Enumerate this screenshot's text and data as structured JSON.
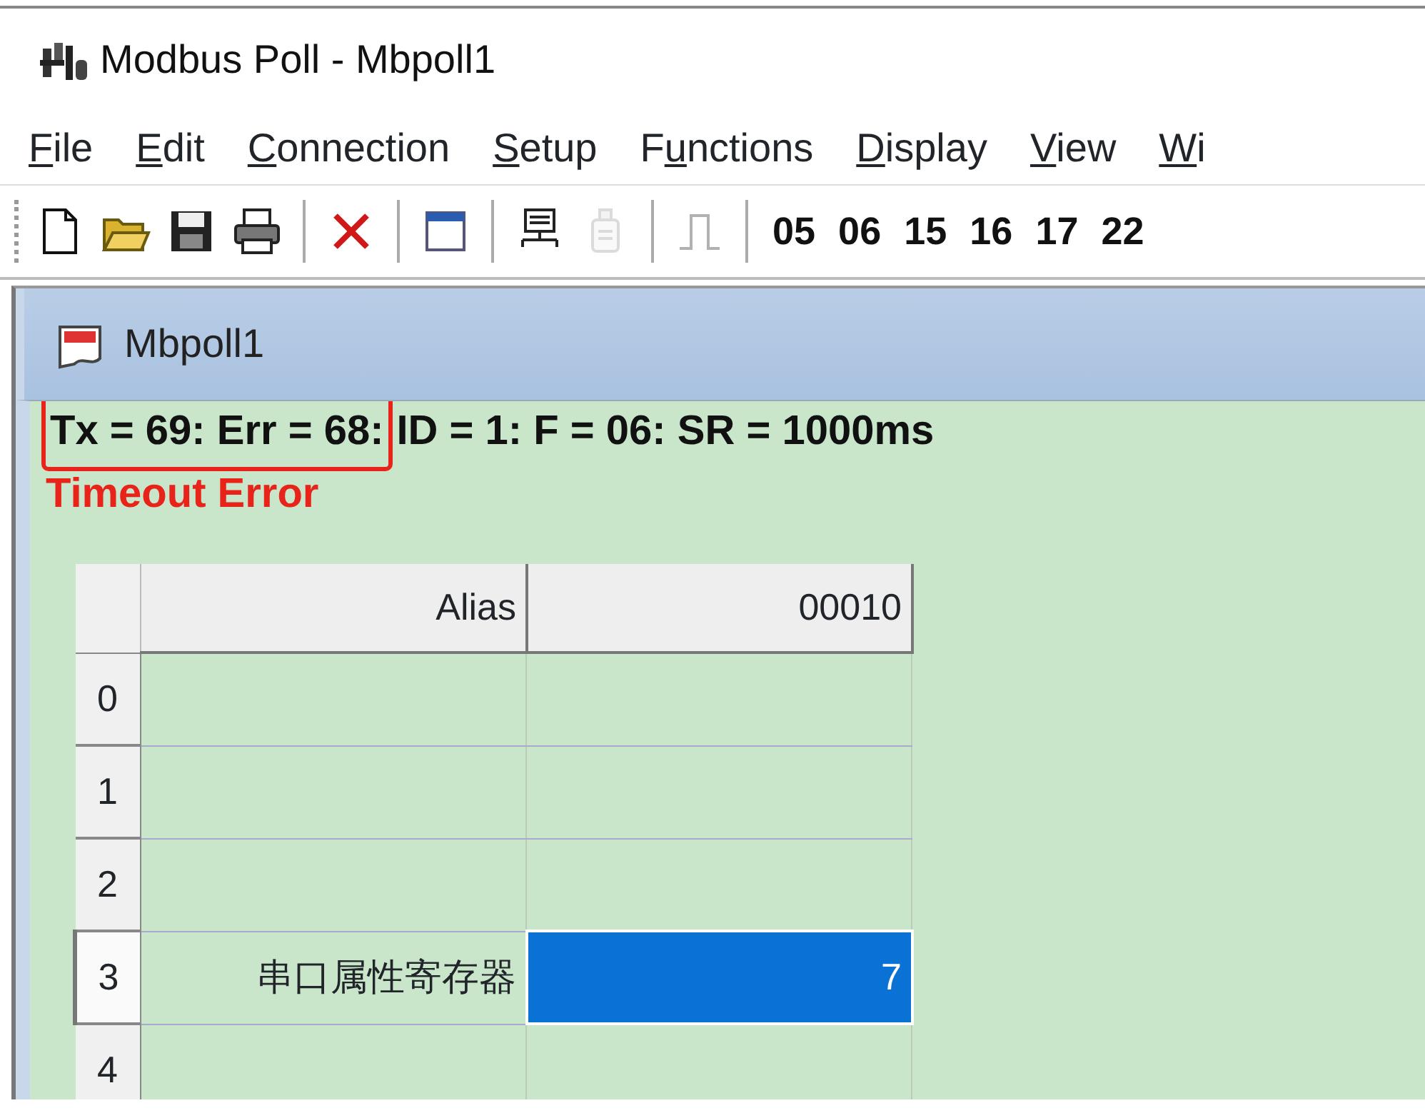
{
  "window": {
    "title": "Modbus Poll - Mbpoll1"
  },
  "menu": [
    {
      "key": "F",
      "rest": "ile"
    },
    {
      "key": "E",
      "rest": "dit"
    },
    {
      "key": "C",
      "rest": "onnection"
    },
    {
      "key": "S",
      "rest": "etup"
    },
    {
      "before": "F",
      "key": "u",
      "rest": "nctions"
    },
    {
      "key": "D",
      "rest": "isplay"
    },
    {
      "key": "V",
      "rest": "iew"
    },
    {
      "key": "W",
      "rest": "i"
    }
  ],
  "toolbar": [
    {
      "kind": "new",
      "disabled": false
    },
    {
      "kind": "open",
      "disabled": false
    },
    {
      "kind": "save",
      "disabled": false
    },
    {
      "kind": "print",
      "disabled": false
    },
    {
      "kind": "sep"
    },
    {
      "kind": "delete",
      "disabled": false
    },
    {
      "kind": "sep"
    },
    {
      "kind": "window",
      "disabled": false
    },
    {
      "kind": "sep"
    },
    {
      "kind": "connect",
      "disabled": false
    },
    {
      "kind": "disconnect",
      "disabled": true
    },
    {
      "kind": "sep"
    },
    {
      "kind": "pulse",
      "disabled": true
    },
    {
      "kind": "sep"
    },
    {
      "kind": "code",
      "label": "05"
    },
    {
      "kind": "code",
      "label": "06"
    },
    {
      "kind": "code",
      "label": "15"
    },
    {
      "kind": "code",
      "label": "16"
    },
    {
      "kind": "code",
      "label": "17"
    },
    {
      "kind": "code",
      "label": "22"
    }
  ],
  "document": {
    "title": "Mbpoll1",
    "status": [
      {
        "text": "Tx = 69: Err = 68:",
        "highlighted": true
      },
      {
        "text": "ID = 1: F = 06: SR = 1000ms",
        "highlighted": false
      }
    ],
    "error": "Timeout Error",
    "table": {
      "columns": [
        "Alias",
        "00010"
      ],
      "rows": [
        {
          "label": "0",
          "selected": false
        },
        {
          "label": "1",
          "selected": false
        },
        {
          "label": "2",
          "selected": false
        },
        {
          "label": "3",
          "alias": "串口属性寄存器",
          "value": "7",
          "selected": true
        },
        {
          "label": "4",
          "selected": false
        }
      ]
    }
  }
}
